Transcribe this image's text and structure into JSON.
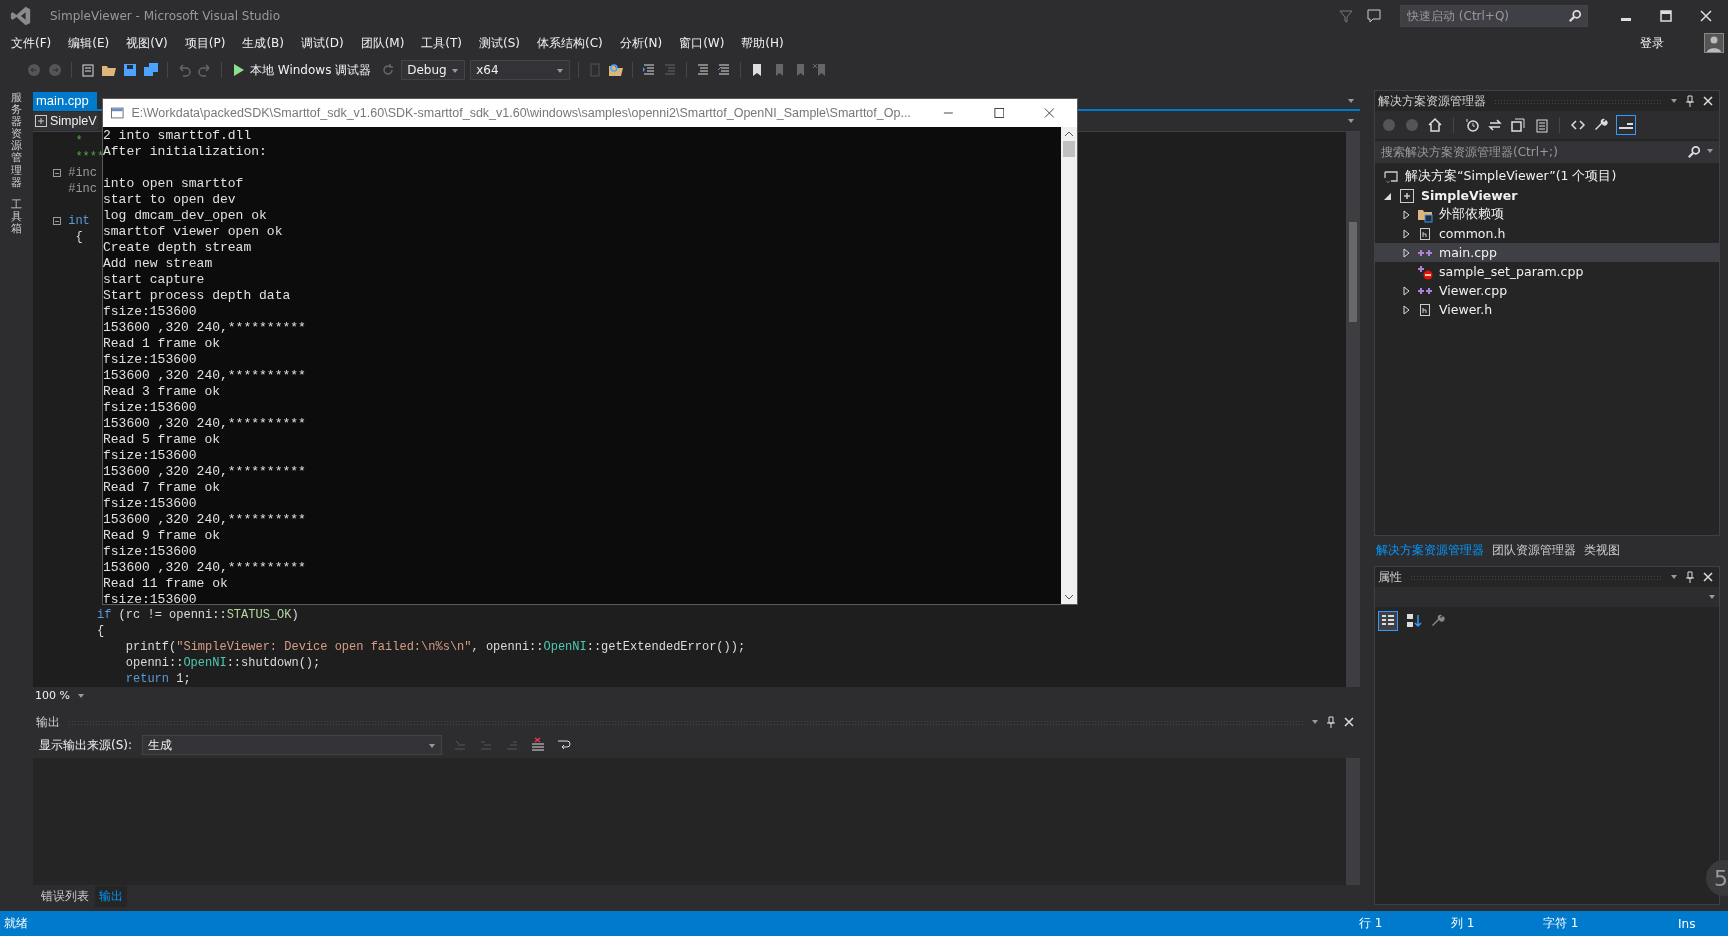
{
  "window": {
    "title": "SimpleViewer - Microsoft Visual Studio",
    "quick_launch": {
      "placeholder": "快速启动 (Ctrl+Q)"
    },
    "sign_in": "登录"
  },
  "menu": [
    "文件(F)",
    "编辑(E)",
    "视图(V)",
    "项目(P)",
    "生成(B)",
    "调试(D)",
    "团队(M)",
    "工具(T)",
    "测试(S)",
    "体系结构(C)",
    "分析(N)",
    "窗口(W)",
    "帮助(H)"
  ],
  "toolbar": {
    "debugger": "本地 Windows 调试器",
    "configuration": "Debug",
    "platform": "x64"
  },
  "side_tabs": [
    "服务器资源管理器",
    "工具箱"
  ],
  "editor": {
    "tabs": [
      {
        "label": "main.cpp",
        "selected": true
      }
    ],
    "nav": "SimpleV",
    "zoom": "100 %",
    "top_blocks": [
      [
        {
          "fold": false,
          "tokens": [
            {
              "kind": "comment",
              "t": " *"
            }
          ]
        },
        {
          "fold": false,
          "tokens": [
            {
              "kind": "comment",
              "t": " ****"
            }
          ]
        },
        {
          "fold": true,
          "tokens": [
            {
              "kind": "pre",
              "t": "#inc"
            }
          ]
        },
        {
          "fold": false,
          "tokens": [
            {
              "kind": "pre",
              "t": "#inc"
            }
          ]
        }
      ],
      [
        {
          "fold": true,
          "tokens": [
            {
              "kind": "keyword",
              "t": "int"
            }
          ]
        },
        {
          "fold": false,
          "tokens": [
            {
              "kind": "plain",
              "t": " {"
            }
          ]
        }
      ]
    ],
    "bottom_lines": [
      {
        "fold": false,
        "tokens": [
          {
            "kind": "keyword",
            "t": "    if"
          },
          {
            "kind": "plain",
            "t": " (rc != openni::"
          },
          {
            "kind": "enum",
            "t": "STATUS_OK"
          },
          {
            "kind": "plain",
            "t": ")"
          }
        ]
      },
      {
        "fold": false,
        "tokens": [
          {
            "kind": "plain",
            "t": "    {"
          }
        ]
      },
      {
        "fold": false,
        "tokens": [
          {
            "kind": "plain",
            "t": "        printf("
          },
          {
            "kind": "string",
            "t": "\"SimpleViewer: Device open failed:\\n%s\\n\""
          },
          {
            "kind": "plain",
            "t": ", openni::"
          },
          {
            "kind": "type",
            "t": "OpenNI"
          },
          {
            "kind": "plain",
            "t": "::getExtendedError());"
          }
        ]
      },
      {
        "fold": false,
        "tokens": [
          {
            "kind": "plain",
            "t": "        openni::"
          },
          {
            "kind": "type",
            "t": "OpenNI"
          },
          {
            "kind": "plain",
            "t": "::shutdown();"
          }
        ]
      },
      {
        "fold": false,
        "tokens": [
          {
            "kind": "keyword",
            "t": "        return"
          },
          {
            "kind": "plain",
            "t": " 1;"
          }
        ]
      }
    ]
  },
  "console": {
    "title": "E:\\Workdata\\packedSDK\\Smarttof_sdk_v1.60\\SDK-smarttof_sdk_v1.60\\windows\\samples\\openni2\\Smarttof_OpenNI_Sample\\Smarttof_Op...",
    "blocks": [
      [
        "2 into smarttof.dll",
        "After initialization:"
      ],
      [
        "into open smarttof",
        "start to open dev",
        "log dmcam_dev_open ok",
        "smarttof viewer open ok",
        "Create depth stream",
        "Add new stream",
        "start capture",
        "Start process depth data",
        "fsize:153600",
        "153600 ,320 240,**********",
        "Read 1 frame ok",
        "fsize:153600",
        "153600 ,320 240,**********",
        "Read 3 frame ok",
        "fsize:153600",
        "153600 ,320 240,**********",
        "Read 5 frame ok",
        "fsize:153600",
        "153600 ,320 240,**********",
        "Read 7 frame ok",
        "fsize:153600",
        "153600 ,320 240,**********",
        "Read 9 frame ok",
        "fsize:153600",
        "153600 ,320 240,**********",
        "Read 11 frame ok",
        "fsize:153600"
      ]
    ]
  },
  "output": {
    "title": "输出",
    "source_label": "显示输出来源(S):",
    "source": "生成"
  },
  "bottom_tabs": [
    {
      "label": "错误列表",
      "selected": false
    },
    {
      "label": "输出",
      "selected": true
    }
  ],
  "solution_explorer": {
    "title": "解决方案资源管理器",
    "search": {
      "placeholder": "搜索解决方案资源管理器(Ctrl+;)"
    },
    "solution": {
      "label": "解决方案“SimpleViewer”(1 个项目)",
      "selected": false
    },
    "projects": [
      {
        "label": "SimpleViewer",
        "selected": false,
        "expanded": true,
        "children": [
          {
            "kind": "references",
            "label": "外部依赖项",
            "selected": false,
            "expandable": true
          },
          {
            "kind": "header",
            "label": "common.h",
            "selected": false,
            "expandable": true
          },
          {
            "kind": "cpp",
            "label": "main.cpp",
            "selected": true,
            "expandable": true
          },
          {
            "kind": "cpp_excluded",
            "label": "sample_set_param.cpp",
            "selected": false,
            "expandable": false
          },
          {
            "kind": "cpp",
            "label": "Viewer.cpp",
            "selected": false,
            "expandable": true
          },
          {
            "kind": "header",
            "label": "Viewer.h",
            "selected": false,
            "expandable": true
          }
        ]
      }
    ]
  },
  "right_tabs": [
    {
      "label": "解决方案资源管理器",
      "selected": true
    },
    {
      "label": "团队资源管理器",
      "selected": false
    },
    {
      "label": "类视图",
      "selected": false
    }
  ],
  "properties": {
    "title": "属性"
  },
  "floating_badge": "5",
  "status_bar": {
    "message": "就绪",
    "line": "行 1",
    "column": "列 1",
    "char": "字符 1",
    "mode": "Ins"
  }
}
